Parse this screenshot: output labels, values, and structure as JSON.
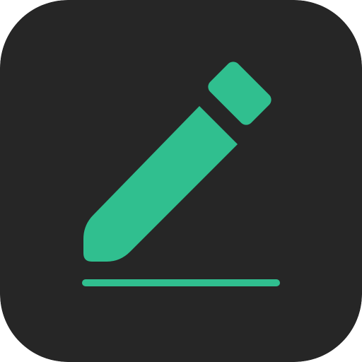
{
  "app_icon": {
    "icon": "edit-pencil-icon",
    "description_visible_text": "",
    "colors": {
      "background": "#262626",
      "accent": "#30BF8F"
    }
  }
}
